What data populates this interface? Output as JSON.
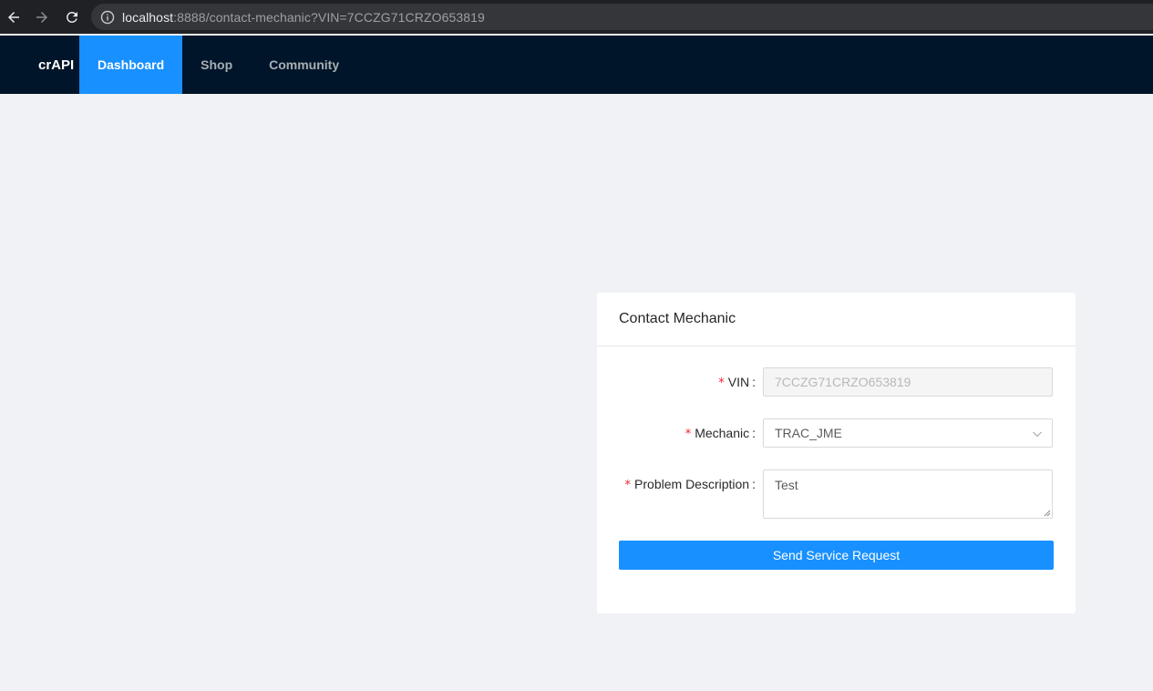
{
  "browser": {
    "url_host": "localhost",
    "url_rest": ":8888/contact-mechanic?VIN=7CCZG71CRZO653819"
  },
  "nav": {
    "brand": "crAPI",
    "items": [
      {
        "label": "Dashboard",
        "active": true
      },
      {
        "label": "Shop",
        "active": false
      },
      {
        "label": "Community",
        "active": false
      }
    ]
  },
  "card": {
    "title": "Contact Mechanic",
    "fields": {
      "vin": {
        "label": "VIN",
        "value": "7CCZG71CRZO653819",
        "disabled": true
      },
      "mechanic": {
        "label": "Mechanic",
        "value": "TRAC_JME"
      },
      "problem": {
        "label": "Problem Description",
        "value": "Test"
      }
    },
    "required_mark": "*",
    "colon": ":",
    "submit_label": "Send Service Request"
  },
  "colors": {
    "primary": "#1890ff",
    "header_bg": "#001529",
    "required": "#f5222d",
    "page_bg": "#f0f2f5"
  }
}
